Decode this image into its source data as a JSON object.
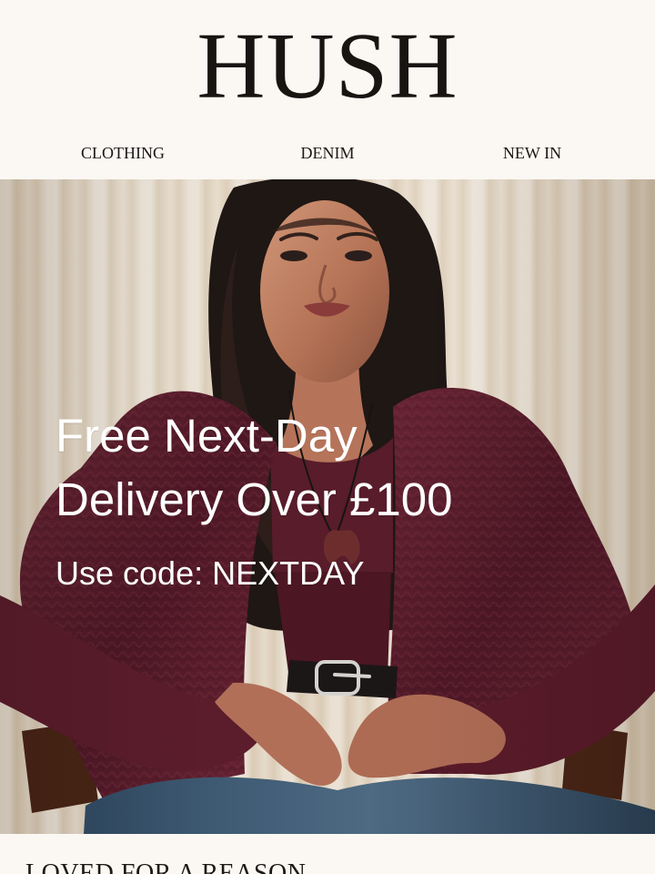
{
  "brand": {
    "logo": "HUSH"
  },
  "navigation": {
    "items": [
      {
        "label": "CLOTHING"
      },
      {
        "label": "DENIM"
      },
      {
        "label": "NEW IN"
      }
    ]
  },
  "hero": {
    "headline_line_1": "Free Next-Day",
    "headline_line_2": "Delivery Over £100",
    "promo_text": "Use code: NEXTDAY",
    "icon": "promotional-photo-image"
  },
  "sections": {
    "next_title": "LOVED FOR A REASON"
  },
  "colors": {
    "background": "#fbf8f4",
    "text": "#1b1714",
    "hero_text": "#ffffff",
    "cardigan": "#5b1d2b",
    "denim": "#3f5870"
  }
}
